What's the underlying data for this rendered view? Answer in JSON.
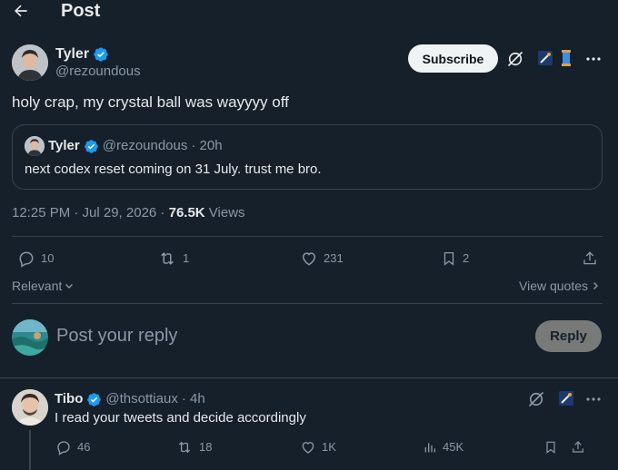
{
  "header": {
    "title": "Post",
    "back_icon": "arrow-left-icon"
  },
  "post": {
    "author_name": "Tyler",
    "author_handle": "@rezoundous",
    "subscribe_label": "Subscribe",
    "text": "holy crap, my crystal ball was wayyyy off",
    "quote": {
      "author_name": "Tyler",
      "author_handle": "@rezoundous",
      "time": "· 20h",
      "text": "next codex reset coming on 31 July. trust me bro."
    },
    "timestamp": "12:25 PM · Jul 29, 2026 · ",
    "views_count": "76.5K",
    "views_label": " Views",
    "actions": {
      "replies": "10",
      "reposts": "1",
      "likes": "231",
      "bookmarks": "2"
    }
  },
  "sort": {
    "label": "Relevant",
    "view_quotes": "View quotes"
  },
  "composer": {
    "placeholder": "Post your reply",
    "reply_label": "Reply"
  },
  "reply": {
    "author_name": "Tibo",
    "author_handle": "@thsottiaux",
    "time": "· 4h",
    "text": "I read your tweets and decide accordingly",
    "actions": {
      "replies": "46",
      "reposts": "18",
      "likes": "1K",
      "views": "45K"
    }
  },
  "colors": {
    "background": "#15202b",
    "verified": "#1d9bf0",
    "muted": "#8b98a5",
    "divider": "#38444d"
  }
}
